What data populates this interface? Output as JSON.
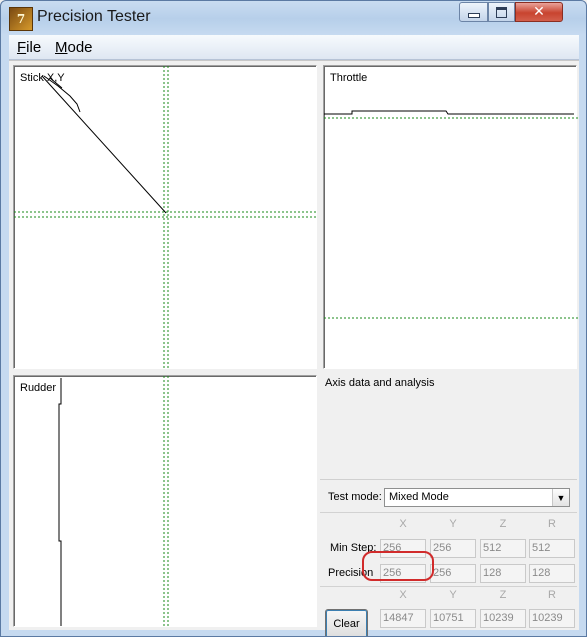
{
  "window": {
    "title": "Precision Tester",
    "app_icon_text": "7"
  },
  "menu": {
    "file_underline": "F",
    "file_rest": "ile",
    "mode_underline": "M",
    "mode_rest": "ode"
  },
  "panels": {
    "stick_label": "Stick X,Y",
    "throttle_label": "Throttle",
    "rudder_label": "Rudder",
    "analysis_label": "Axis data and analysis"
  },
  "controls": {
    "test_mode_label": "Test mode:",
    "test_mode_value": "Mixed Mode",
    "columns": [
      "X",
      "Y",
      "Z",
      "R"
    ],
    "min_step_label": "Min Step:",
    "min_step": [
      "256",
      "256",
      "512",
      "512"
    ],
    "precision_label": "Precision",
    "precision": [
      "256",
      "256",
      "128",
      "128"
    ],
    "clear_label": "Clear",
    "raw_values": [
      "14847",
      "10751",
      "10239",
      "10239"
    ]
  },
  "colors": {
    "guide_line": "#1a8a1a",
    "highlight": "#d12b2b"
  }
}
